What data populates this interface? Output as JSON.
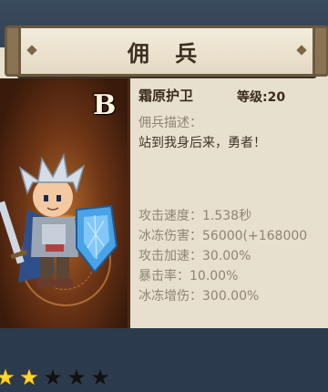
{
  "title": "佣 兵",
  "card": {
    "grade": "B",
    "stars": [
      true,
      true,
      false,
      false,
      false
    ]
  },
  "info": {
    "name": "霜原护卫",
    "level_label": "等级",
    "level_value": ":20",
    "desc_label": "佣兵描述：",
    "desc_text": "站到我身后来，勇者！"
  },
  "stats": [
    {
      "label": "攻击速度",
      "value": "：1.538秒"
    },
    {
      "label": "冰冻伤害",
      "value": "：56000(+168000"
    },
    {
      "label": "攻击加速",
      "value": "：30.00%"
    },
    {
      "label": "暴击率",
      "value": "：10.00%"
    },
    {
      "label": "冰冻增伤",
      "value": "：300.00%"
    }
  ],
  "colors": {
    "panel": "#e8e0cf",
    "title_text": "#3b2f22",
    "star_on": "#ffd52a"
  }
}
